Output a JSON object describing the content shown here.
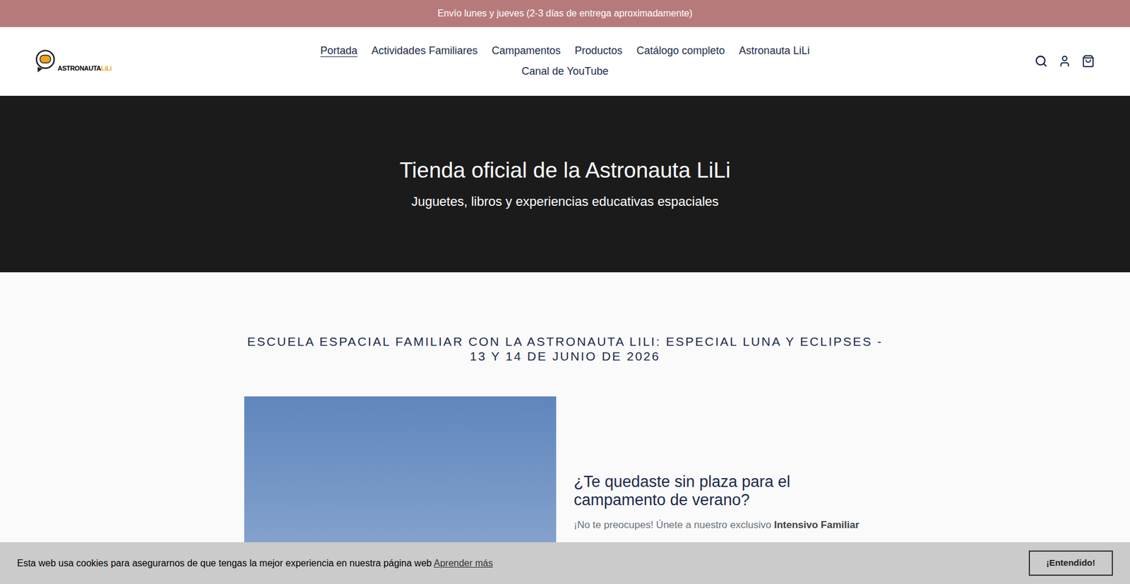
{
  "announcement": "Envío lunes y jueves (2-3 días de entrega aproximadamente)",
  "logo": {
    "brand": "ASTRONAUTA",
    "accent": "LiLi"
  },
  "nav": [
    {
      "label": "Portada",
      "selected": true
    },
    {
      "label": "Actividades Familiares",
      "selected": false
    },
    {
      "label": "Campamentos",
      "selected": false
    },
    {
      "label": "Productos",
      "selected": false
    },
    {
      "label": "Catálogo completo",
      "selected": false
    },
    {
      "label": "Astronauta LiLi",
      "selected": false
    },
    {
      "label": "Canal de YouTube",
      "selected": false
    }
  ],
  "hero": {
    "title": "Tienda oficial de la Astronauta LiLi",
    "subtitle": "Juguetes, libros y experiencias educativas espaciales"
  },
  "section": {
    "heading": "ESCUELA ESPACIAL FAMILIAR CON LA ASTRONAUTA LILI: ESPECIAL LUNA Y ECLIPSES - 13 Y 14 DE JUNIO DE 2026",
    "feature_heading": "¿Te quedaste sin plaza para el campamento de verano?",
    "paragraph": "¡No te preocupes! Únete a nuestro exclusivo",
    "paragraph_bold": "Intensivo Familiar"
  },
  "cookie": {
    "text": "Esta web usa cookies para asegurarnos de que tengas la mejor experiencia en nuestra página web",
    "link": "Aprender más",
    "button": "¡Entendido!"
  }
}
